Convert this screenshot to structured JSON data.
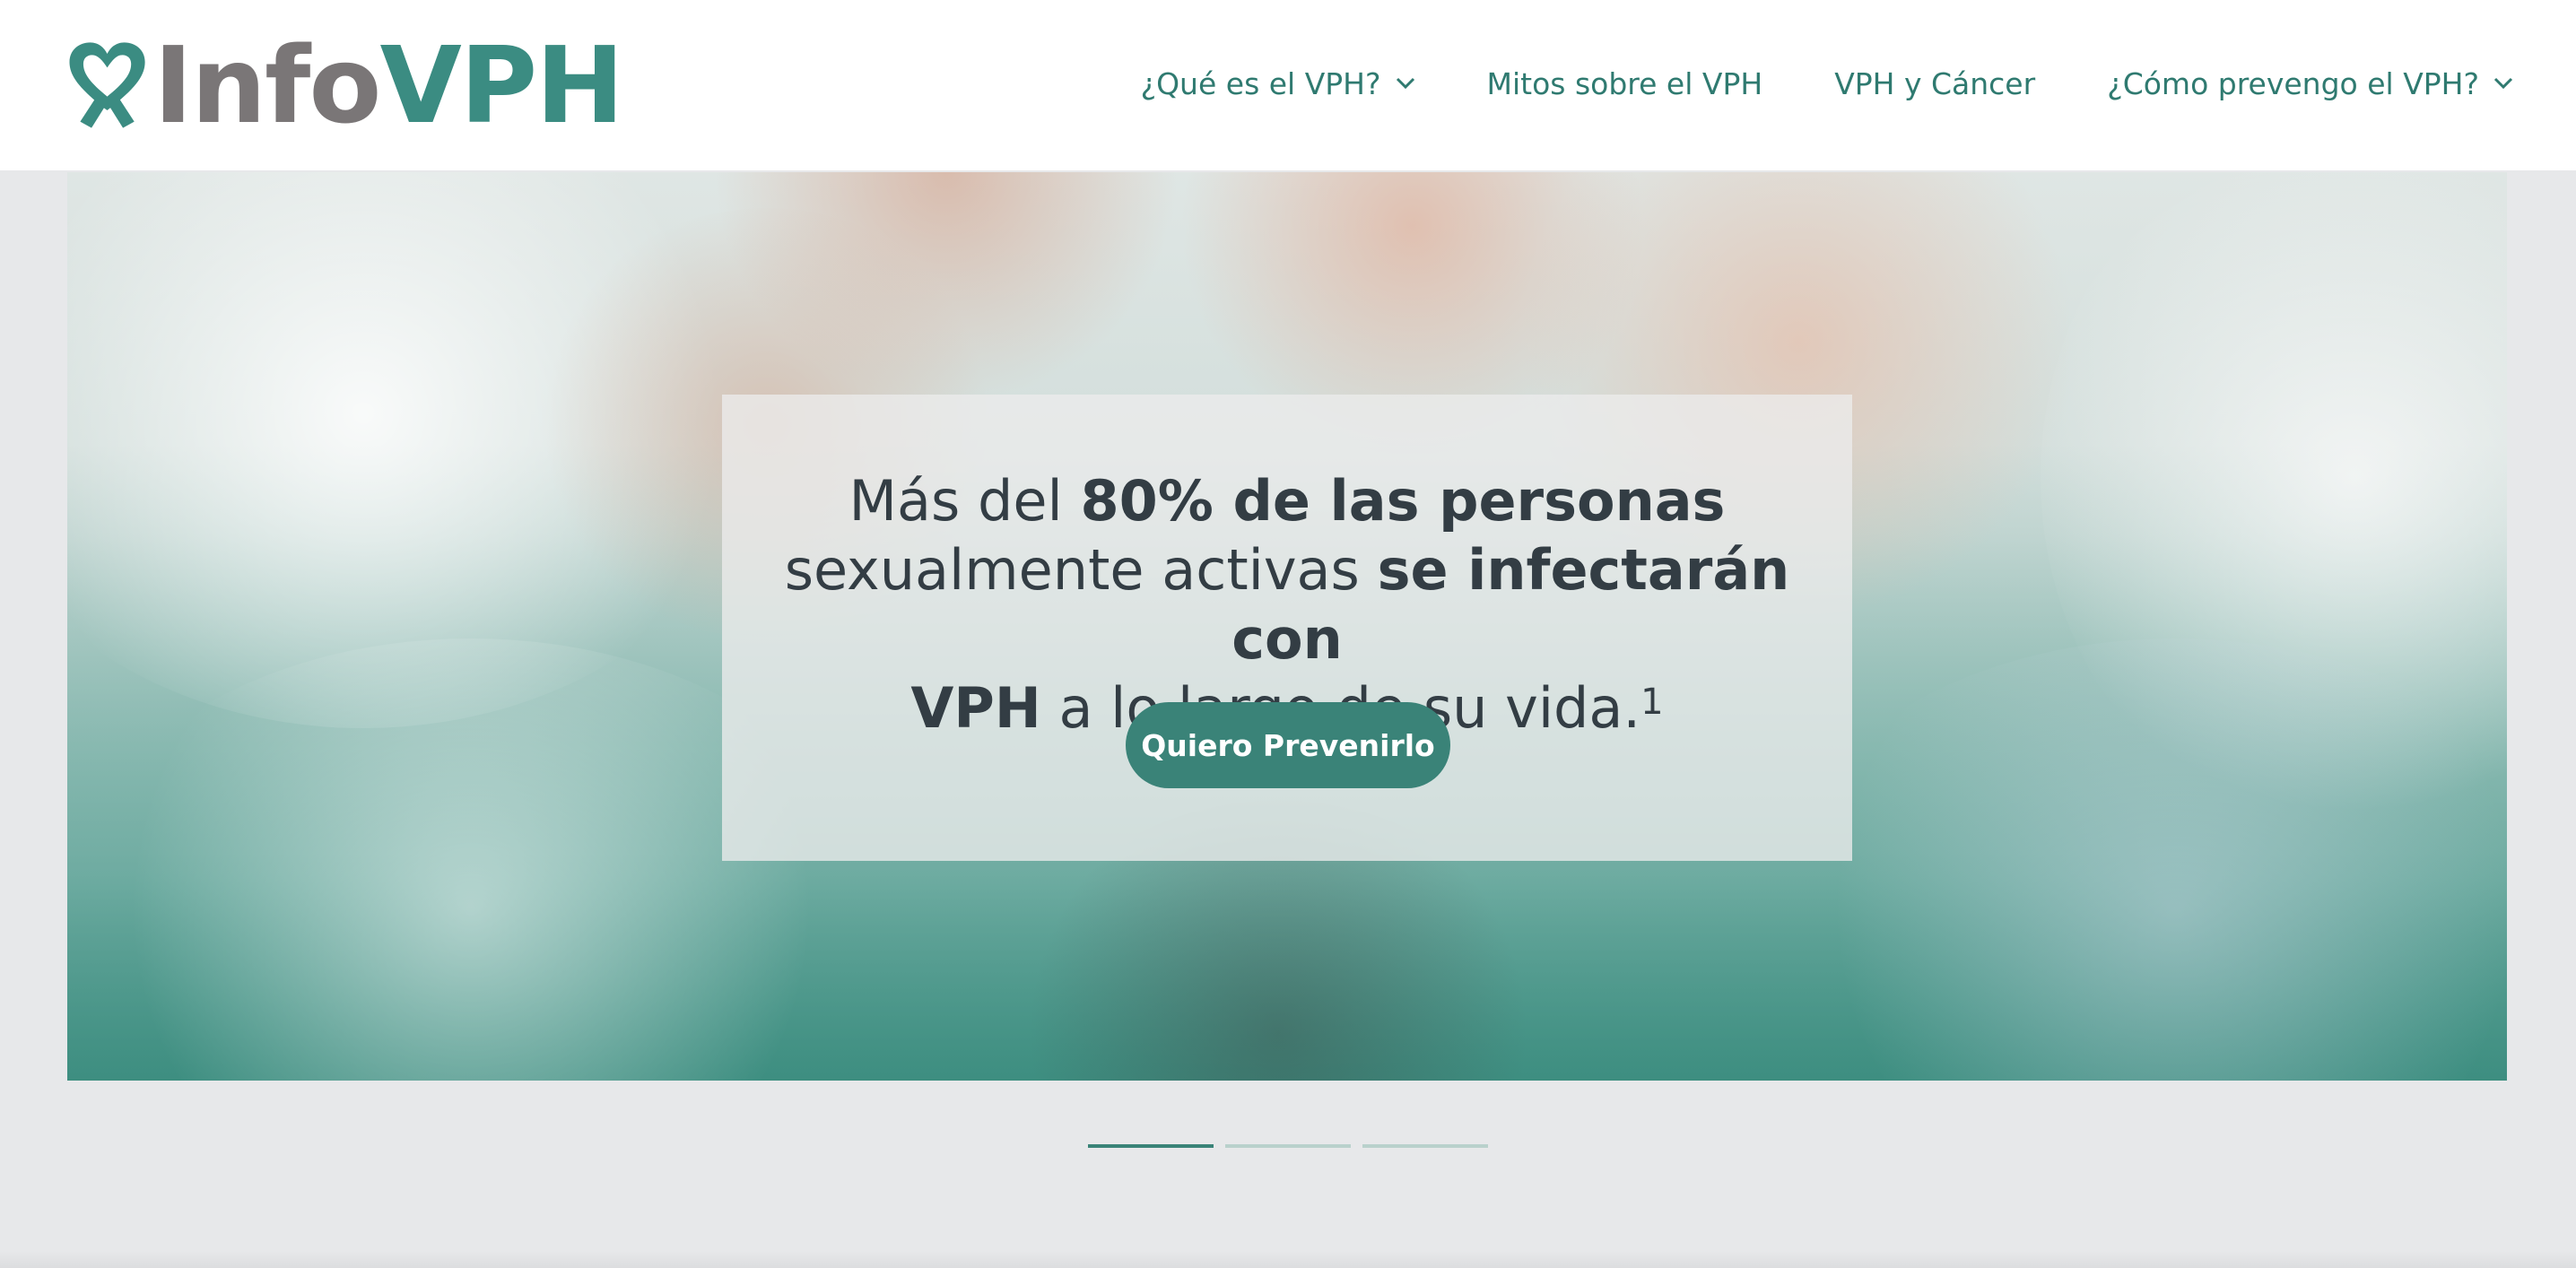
{
  "brand": {
    "part1": "Info",
    "part2": "VPH",
    "color_primary": "#3b8c82",
    "color_grey": "#7a7677",
    "icon": "heart-ribbon-icon"
  },
  "nav": {
    "items": [
      {
        "label": "¿Qué es el VPH?",
        "has_dropdown": true
      },
      {
        "label": "Mitos sobre el VPH",
        "has_dropdown": false
      },
      {
        "label": "VPH y Cáncer",
        "has_dropdown": false
      },
      {
        "label": "¿Cómo prevengo el VPH?",
        "has_dropdown": true
      }
    ]
  },
  "hero": {
    "line1_pre": "Más del ",
    "line1_bold": "80% de las personas",
    "line2_pre": "sexualmente activas ",
    "line2_bold": "se infectarán con",
    "line3_bold": "VPH",
    "line3_post": " a lo largo de su vida.",
    "footnote": "1",
    "cta_label": "Quiero Prevenirlo"
  },
  "carousel": {
    "slide_count": 3,
    "active_index": 0
  },
  "colors": {
    "accent": "#3a8378",
    "text_dark": "#333d44",
    "page_bg": "#e7e8ea"
  }
}
